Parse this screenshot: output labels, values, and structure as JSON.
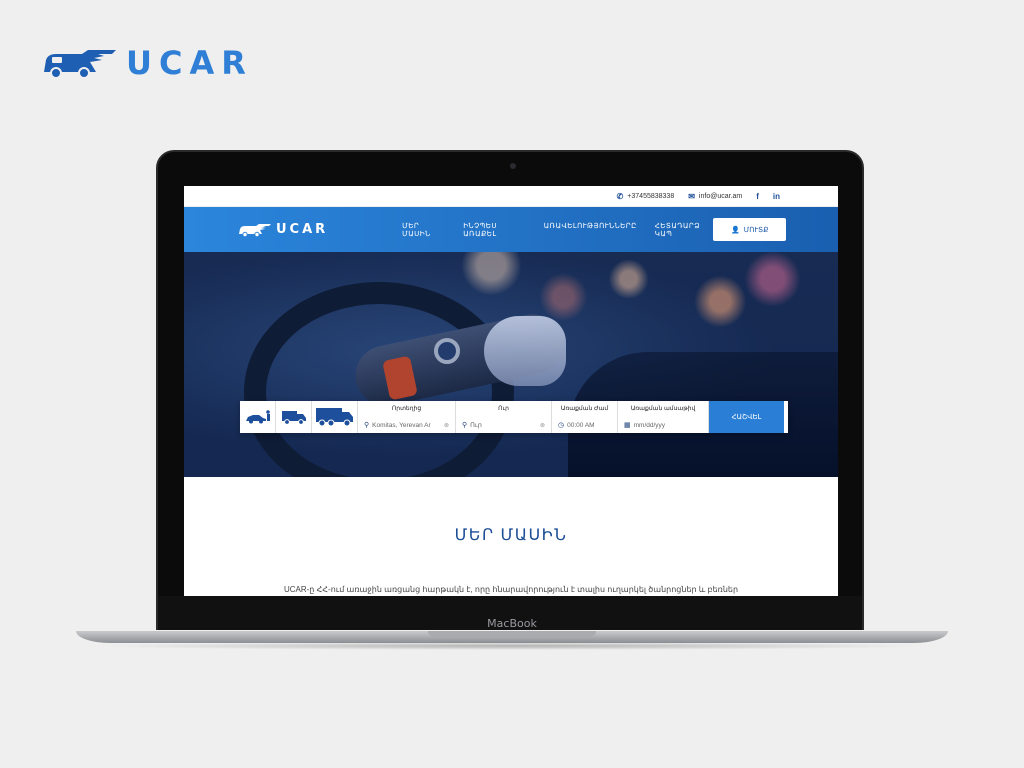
{
  "brand": {
    "name": "UCAR"
  },
  "topbar": {
    "phone": "+37455838338",
    "email": "info@ucar.am",
    "social": [
      "f",
      "in"
    ]
  },
  "nav": {
    "logo": "UCAR",
    "links": [
      "ՄԵՐ ՄԱՍԻՆ",
      "ԻՆՉՊԵՍ ԱՌԱՔԵԼ",
      "ԱՌԱՎԵԼՈՒԹՅՈՒՆՆԵՐԸ",
      "ՀԵՏԱԴԱՐՁ ԿԱՊ"
    ],
    "login": "ՄՈՒՏՔ"
  },
  "search": {
    "from_label": "Որտեղից",
    "from_value": "Komitas, Yerevan Ar",
    "to_label": "Ուր",
    "to_value": "Ուր",
    "time_label": "Առաքման Ժամ",
    "time_value": "00:00 AM",
    "date_label": "Առաքման ամսաթիվ",
    "date_value": "mm/dd/yyy",
    "button": "ՀԱՇՎԵԼ"
  },
  "about": {
    "title": "ՄԵՐ ՄԱՍԻՆ",
    "text": "UCAR-ը ՀՀ-ում առաջին առցանց հարթակն է, որը հնարավորություն է տալիս ուղարկել ծանրոցներ և բեռներ"
  },
  "device": {
    "label": "MacBook"
  },
  "colors": {
    "accent": "#2a7ed6",
    "nav_dark": "#1a5fb0",
    "title": "#1a4d96"
  }
}
